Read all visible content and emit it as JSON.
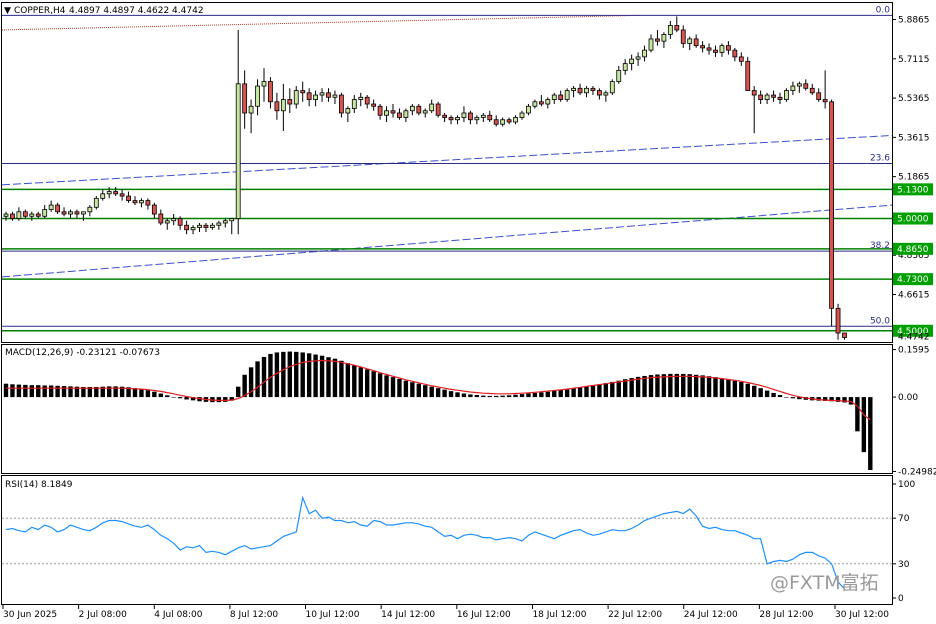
{
  "header": {
    "symbol": "COPPER,H4",
    "ohlc": "4.4897 4.4897 4.4622 4.4742",
    "triangle_icon": "triangle-down-icon"
  },
  "colors": {
    "background": "#ffffff",
    "frame": "#000000",
    "bull_candle": "#c8e6a0",
    "bear_candle": "#d9534f",
    "horizontal_level": "#008000",
    "level_label_bg": "#00a000",
    "fib_line": "#2a2a8a",
    "channel_line": "#3a4fd0",
    "ma_red": "#c0392b",
    "macd_hist": "#000000",
    "macd_signal": "#e02020",
    "rsi_line": "#1e90ff",
    "watermark": "#9a9a9a"
  },
  "chart_data": [
    {
      "type": "candlestick",
      "panel": "price",
      "ylim": [
        4.45,
        5.96
      ],
      "y_ticks": [
        "5.8865",
        "5.7115",
        "5.5365",
        "5.3615",
        "5.1865",
        "4.8365",
        "4.6615"
      ],
      "bid_price": "4.4742",
      "x_labels": [
        "30 Jun 2025",
        "2 Jul 08:00",
        "4 Jul 08:00",
        "8 Jul 12:00",
        "10 Jul 12:00",
        "14 Jul 12:00",
        "16 Jul 12:00",
        "18 Jul 12:00",
        "22 Jul 12:00",
        "24 Jul 12:00",
        "28 Jul 12:00",
        "30 Jul 12:00"
      ],
      "horizontal_levels": [
        {
          "label": "5.1300",
          "value": 5.13
        },
        {
          "label": "5.0000",
          "value": 5.0
        },
        {
          "label": "4.8650",
          "value": 4.865
        },
        {
          "label": "4.7300",
          "value": 4.73
        },
        {
          "label": "4.5000",
          "value": 4.5
        }
      ],
      "fibonacci_levels": [
        {
          "label": "0.0",
          "value": 5.905
        },
        {
          "label": "23.6",
          "value": 5.245
        },
        {
          "label": "38.2",
          "value": 4.855
        },
        {
          "label": "50.0",
          "value": 4.52
        }
      ],
      "channel": {
        "upper": [
          5.15,
          5.37
        ],
        "lower": [
          4.74,
          5.06
        ]
      },
      "moving_average": {
        "start": 5.84,
        "end": 5.905
      },
      "ohlc": [
        [
          5.01,
          5.03,
          4.99,
          5.02
        ],
        [
          5.02,
          5.03,
          4.99,
          5.0
        ],
        [
          5.0,
          5.05,
          4.99,
          5.03
        ],
        [
          5.03,
          5.04,
          5.0,
          5.01
        ],
        [
          5.01,
          5.03,
          4.99,
          5.02
        ],
        [
          5.02,
          5.03,
          5.0,
          5.01
        ],
        [
          5.01,
          5.06,
          5.0,
          5.04
        ],
        [
          5.04,
          5.08,
          5.03,
          5.06
        ],
        [
          5.06,
          5.07,
          5.02,
          5.03
        ],
        [
          5.03,
          5.05,
          5.01,
          5.02
        ],
        [
          5.02,
          5.04,
          5.0,
          5.03
        ],
        [
          5.03,
          5.04,
          5.0,
          5.02
        ],
        [
          5.02,
          5.03,
          4.99,
          5.03
        ],
        [
          5.03,
          5.06,
          5.01,
          5.05
        ],
        [
          5.05,
          5.1,
          5.04,
          5.09
        ],
        [
          5.09,
          5.13,
          5.08,
          5.11
        ],
        [
          5.11,
          5.14,
          5.09,
          5.12
        ],
        [
          5.12,
          5.14,
          5.1,
          5.11
        ],
        [
          5.11,
          5.13,
          5.08,
          5.1
        ],
        [
          5.1,
          5.12,
          5.07,
          5.08
        ],
        [
          5.08,
          5.1,
          5.06,
          5.07
        ],
        [
          5.07,
          5.09,
          5.05,
          5.08
        ],
        [
          5.08,
          5.09,
          5.04,
          5.06
        ],
        [
          5.06,
          5.07,
          5.0,
          5.02
        ],
        [
          5.02,
          5.04,
          4.97,
          4.98
        ],
        [
          4.98,
          5.0,
          4.95,
          4.99
        ],
        [
          4.99,
          5.02,
          4.97,
          5.0
        ],
        [
          5.0,
          5.01,
          4.95,
          4.97
        ],
        [
          4.97,
          4.99,
          4.93,
          4.95
        ],
        [
          4.95,
          4.97,
          4.93,
          4.96
        ],
        [
          4.96,
          4.98,
          4.94,
          4.97
        ],
        [
          4.97,
          4.98,
          4.94,
          4.96
        ],
        [
          4.96,
          4.98,
          4.95,
          4.97
        ],
        [
          4.97,
          4.99,
          4.95,
          4.98
        ],
        [
          4.98,
          5.0,
          4.96,
          4.99
        ],
        [
          4.99,
          5.0,
          4.93,
          5.0
        ],
        [
          5.0,
          5.84,
          4.93,
          5.6
        ],
        [
          5.6,
          5.66,
          5.4,
          5.47
        ],
        [
          5.47,
          5.53,
          5.38,
          5.5
        ],
        [
          5.5,
          5.62,
          5.46,
          5.59
        ],
        [
          5.59,
          5.67,
          5.52,
          5.61
        ],
        [
          5.61,
          5.63,
          5.49,
          5.52
        ],
        [
          5.52,
          5.56,
          5.44,
          5.48
        ],
        [
          5.48,
          5.6,
          5.39,
          5.53
        ],
        [
          5.53,
          5.58,
          5.47,
          5.51
        ],
        [
          5.51,
          5.59,
          5.49,
          5.57
        ],
        [
          5.57,
          5.61,
          5.52,
          5.56
        ],
        [
          5.56,
          5.58,
          5.5,
          5.53
        ],
        [
          5.53,
          5.57,
          5.5,
          5.55
        ],
        [
          5.55,
          5.58,
          5.52,
          5.56
        ],
        [
          5.56,
          5.58,
          5.52,
          5.54
        ],
        [
          5.54,
          5.57,
          5.51,
          5.55
        ],
        [
          5.55,
          5.56,
          5.45,
          5.47
        ],
        [
          5.47,
          5.5,
          5.43,
          5.49
        ],
        [
          5.49,
          5.55,
          5.47,
          5.53
        ],
        [
          5.53,
          5.56,
          5.5,
          5.54
        ],
        [
          5.54,
          5.55,
          5.49,
          5.51
        ],
        [
          5.51,
          5.53,
          5.48,
          5.5
        ],
        [
          5.5,
          5.51,
          5.44,
          5.46
        ],
        [
          5.46,
          5.5,
          5.43,
          5.48
        ],
        [
          5.48,
          5.51,
          5.45,
          5.47
        ],
        [
          5.47,
          5.49,
          5.44,
          5.45
        ],
        [
          5.45,
          5.49,
          5.43,
          5.48
        ],
        [
          5.48,
          5.51,
          5.46,
          5.5
        ],
        [
          5.5,
          5.51,
          5.46,
          5.47
        ],
        [
          5.47,
          5.49,
          5.45,
          5.48
        ],
        [
          5.48,
          5.53,
          5.47,
          5.51
        ],
        [
          5.51,
          5.52,
          5.45,
          5.46
        ],
        [
          5.46,
          5.47,
          5.43,
          5.45
        ],
        [
          5.45,
          5.46,
          5.42,
          5.44
        ],
        [
          5.44,
          5.46,
          5.42,
          5.45
        ],
        [
          5.45,
          5.5,
          5.43,
          5.47
        ],
        [
          5.47,
          5.48,
          5.42,
          5.44
        ],
        [
          5.44,
          5.46,
          5.42,
          5.45
        ],
        [
          5.45,
          5.47,
          5.43,
          5.46
        ],
        [
          5.46,
          5.48,
          5.43,
          5.44
        ],
        [
          5.44,
          5.46,
          5.41,
          5.42
        ],
        [
          5.42,
          5.45,
          5.41,
          5.44
        ],
        [
          5.44,
          5.45,
          5.42,
          5.43
        ],
        [
          5.43,
          5.46,
          5.42,
          5.45
        ],
        [
          5.45,
          5.48,
          5.44,
          5.47
        ],
        [
          5.47,
          5.51,
          5.46,
          5.5
        ],
        [
          5.5,
          5.53,
          5.49,
          5.52
        ],
        [
          5.52,
          5.55,
          5.5,
          5.51
        ],
        [
          5.51,
          5.54,
          5.49,
          5.53
        ],
        [
          5.53,
          5.56,
          5.51,
          5.55
        ],
        [
          5.55,
          5.57,
          5.52,
          5.53
        ],
        [
          5.53,
          5.58,
          5.52,
          5.57
        ],
        [
          5.57,
          5.59,
          5.54,
          5.58
        ],
        [
          5.58,
          5.6,
          5.55,
          5.56
        ],
        [
          5.56,
          5.59,
          5.54,
          5.58
        ],
        [
          5.58,
          5.59,
          5.55,
          5.57
        ],
        [
          5.57,
          5.58,
          5.53,
          5.55
        ],
        [
          5.55,
          5.57,
          5.52,
          5.56
        ],
        [
          5.56,
          5.62,
          5.55,
          5.61
        ],
        [
          5.61,
          5.68,
          5.6,
          5.66
        ],
        [
          5.66,
          5.71,
          5.64,
          5.69
        ],
        [
          5.69,
          5.73,
          5.66,
          5.71
        ],
        [
          5.71,
          5.74,
          5.68,
          5.72
        ],
        [
          5.72,
          5.77,
          5.7,
          5.75
        ],
        [
          5.75,
          5.82,
          5.74,
          5.8
        ],
        [
          5.8,
          5.84,
          5.77,
          5.79
        ],
        [
          5.79,
          5.83,
          5.76,
          5.82
        ],
        [
          5.82,
          5.88,
          5.8,
          5.86
        ],
        [
          5.86,
          5.9,
          5.83,
          5.84
        ],
        [
          5.84,
          5.86,
          5.76,
          5.78
        ],
        [
          5.78,
          5.81,
          5.75,
          5.8
        ],
        [
          5.8,
          5.82,
          5.76,
          5.77
        ],
        [
          5.77,
          5.79,
          5.74,
          5.76
        ],
        [
          5.76,
          5.78,
          5.73,
          5.75
        ],
        [
          5.75,
          5.77,
          5.72,
          5.74
        ],
        [
          5.74,
          5.78,
          5.72,
          5.77
        ],
        [
          5.77,
          5.79,
          5.73,
          5.75
        ],
        [
          5.75,
          5.76,
          5.7,
          5.72
        ],
        [
          5.72,
          5.74,
          5.68,
          5.7
        ],
        [
          5.7,
          5.72,
          5.62,
          5.57
        ],
        [
          5.57,
          5.59,
          5.38,
          5.55
        ],
        [
          5.55,
          5.57,
          5.51,
          5.53
        ],
        [
          5.53,
          5.56,
          5.51,
          5.55
        ],
        [
          5.55,
          5.57,
          5.52,
          5.54
        ],
        [
          5.54,
          5.56,
          5.51,
          5.53
        ],
        [
          5.53,
          5.58,
          5.52,
          5.57
        ],
        [
          5.57,
          5.61,
          5.55,
          5.59
        ],
        [
          5.59,
          5.61,
          5.56,
          5.6
        ],
        [
          5.6,
          5.62,
          5.57,
          5.58
        ],
        [
          5.58,
          5.6,
          5.55,
          5.56
        ],
        [
          5.56,
          5.58,
          5.52,
          5.53
        ],
        [
          5.53,
          5.66,
          5.49,
          5.52
        ],
        [
          5.52,
          5.53,
          4.52,
          4.6
        ],
        [
          4.6,
          4.62,
          4.46,
          4.49
        ],
        [
          4.49,
          4.49,
          4.46,
          4.47
        ]
      ]
    },
    {
      "type": "histogram",
      "panel": "macd",
      "label": "MACD(12,26,9) -0.23121 -0.07673",
      "ylim": [
        -0.255,
        0.175
      ],
      "y_ticks": [
        "0.1595",
        "0.00",
        "-0.24982"
      ],
      "hist_main": [
        0.045,
        0.043,
        0.042,
        0.041,
        0.04,
        0.04,
        0.039,
        0.039,
        0.038,
        0.037,
        0.036,
        0.035,
        0.034,
        0.034,
        0.034,
        0.035,
        0.036,
        0.036,
        0.035,
        0.033,
        0.03,
        0.027,
        0.023,
        0.018,
        0.012,
        0.006,
        0.0,
        -0.004,
        -0.008,
        -0.011,
        -0.014,
        -0.016,
        -0.017,
        -0.017,
        -0.016,
        -0.012,
        0.035,
        0.075,
        0.1,
        0.12,
        0.135,
        0.145,
        0.15,
        0.152,
        0.153,
        0.152,
        0.15,
        0.147,
        0.143,
        0.139,
        0.134,
        0.129,
        0.122,
        0.114,
        0.107,
        0.1,
        0.093,
        0.087,
        0.08,
        0.073,
        0.067,
        0.061,
        0.055,
        0.05,
        0.045,
        0.04,
        0.035,
        0.03,
        0.025,
        0.02,
        0.016,
        0.012,
        0.009,
        0.007,
        0.005,
        0.004,
        0.004,
        0.005,
        0.006,
        0.008,
        0.01,
        0.012,
        0.014,
        0.016,
        0.018,
        0.021,
        0.024,
        0.027,
        0.03,
        0.033,
        0.036,
        0.04,
        0.043,
        0.047,
        0.051,
        0.055,
        0.06,
        0.064,
        0.068,
        0.071,
        0.074,
        0.076,
        0.077,
        0.078,
        0.078,
        0.078,
        0.077,
        0.075,
        0.073,
        0.07,
        0.067,
        0.063,
        0.059,
        0.055,
        0.051,
        0.045,
        0.038,
        0.03,
        0.022,
        0.014,
        0.007,
        0.0,
        -0.004,
        -0.007,
        -0.009,
        -0.011,
        -0.012,
        -0.013,
        -0.014,
        -0.016,
        -0.018,
        -0.025,
        -0.115,
        -0.185,
        -0.245
      ],
      "signal": [
        0.03,
        0.03,
        0.03,
        0.03,
        0.03,
        0.03,
        0.03,
        0.03,
        0.03,
        0.03,
        0.03,
        0.03,
        0.03,
        0.03,
        0.03,
        0.03,
        0.03,
        0.03,
        0.03,
        0.029,
        0.028,
        0.027,
        0.025,
        0.022,
        0.019,
        0.015,
        0.011,
        0.006,
        0.002,
        -0.002,
        -0.005,
        -0.008,
        -0.01,
        -0.011,
        -0.011,
        -0.01,
        -0.005,
        0.005,
        0.018,
        0.033,
        0.05,
        0.066,
        0.08,
        0.092,
        0.102,
        0.11,
        0.116,
        0.12,
        0.122,
        0.123,
        0.122,
        0.12,
        0.117,
        0.112,
        0.107,
        0.101,
        0.095,
        0.089,
        0.082,
        0.076,
        0.07,
        0.064,
        0.058,
        0.053,
        0.048,
        0.043,
        0.038,
        0.034,
        0.03,
        0.026,
        0.023,
        0.02,
        0.017,
        0.015,
        0.013,
        0.012,
        0.011,
        0.011,
        0.011,
        0.012,
        0.013,
        0.014,
        0.016,
        0.018,
        0.02,
        0.022,
        0.024,
        0.027,
        0.03,
        0.033,
        0.036,
        0.039,
        0.042,
        0.045,
        0.048,
        0.051,
        0.054,
        0.057,
        0.06,
        0.063,
        0.065,
        0.067,
        0.068,
        0.069,
        0.07,
        0.07,
        0.07,
        0.069,
        0.068,
        0.066,
        0.064,
        0.062,
        0.059,
        0.056,
        0.053,
        0.049,
        0.044,
        0.039,
        0.033,
        0.026,
        0.019,
        0.012,
        0.006,
        0.001,
        -0.003,
        -0.006,
        -0.008,
        -0.01,
        -0.011,
        -0.012,
        -0.013,
        -0.015,
        -0.03,
        -0.06,
        -0.077
      ]
    },
    {
      "type": "line",
      "panel": "rsi",
      "label": "RSI(14) 8.1849",
      "ylim": [
        0,
        100
      ],
      "y_ticks": [
        "100",
        "70",
        "30",
        "0"
      ],
      "levels": [
        70,
        30
      ],
      "values": [
        60,
        61,
        59,
        58,
        62,
        60,
        64,
        62,
        58,
        60,
        64,
        62,
        60,
        59,
        62,
        66,
        68,
        68,
        67,
        65,
        63,
        62,
        64,
        60,
        55,
        52,
        48,
        42,
        45,
        44,
        46,
        40,
        41,
        40,
        38,
        41,
        44,
        46,
        43,
        44,
        45,
        46,
        50,
        54,
        56,
        58,
        88,
        74,
        77,
        70,
        71,
        68,
        68,
        66,
        67,
        64,
        63,
        68,
        67,
        64,
        64,
        65,
        66,
        66,
        65,
        63,
        62,
        58,
        54,
        55,
        52,
        55,
        56,
        55,
        53,
        53,
        51,
        52,
        53,
        52,
        50,
        55,
        58,
        56,
        54,
        52,
        55,
        57,
        59,
        60,
        57,
        55,
        56,
        58,
        60,
        59,
        59,
        61,
        64,
        68,
        70,
        72,
        74,
        75,
        76,
        74,
        78,
        72,
        63,
        61,
        62,
        60,
        59,
        59,
        57,
        55,
        52,
        52,
        30,
        32,
        33,
        32,
        34,
        38,
        40,
        40,
        37,
        35,
        30,
        14,
        8
      ]
    },
    {
      "type": "table",
      "panel": "watermark",
      "text": "@FXTM富拓"
    }
  ]
}
